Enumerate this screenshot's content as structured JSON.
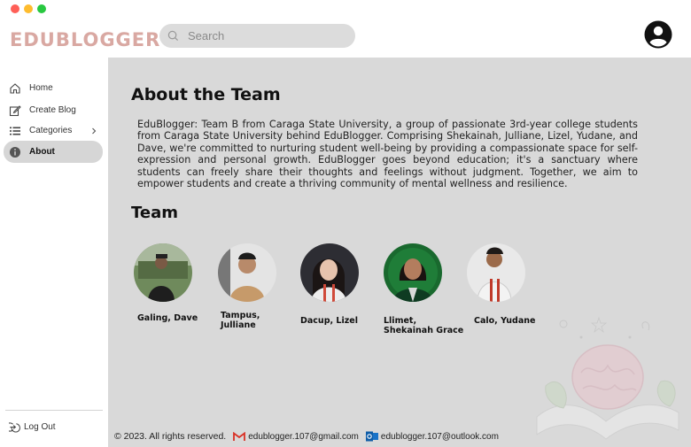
{
  "app": {
    "logo_text": "EDUBLOGGER",
    "colors": {
      "logo": "#d9a8a2",
      "main_bg": "#d9d9d9",
      "active_nav": "#d6d6d6"
    }
  },
  "header": {
    "search": {
      "placeholder": "Search",
      "icon": "search-icon"
    },
    "profile_icon": "user-circle-icon"
  },
  "sidebar": {
    "items": [
      {
        "label": "Home",
        "icon": "home-icon"
      },
      {
        "label": "Create Blog",
        "icon": "edit-icon"
      },
      {
        "label": "Categories",
        "icon": "list-icon"
      },
      {
        "label": "About",
        "icon": "info-icon",
        "active": true
      }
    ],
    "logout_label": "Log Out"
  },
  "main": {
    "title": "About the Team",
    "description": "EduBlogger: Team B from Caraga State University, a group of passionate 3rd-year college students from Caraga State University behind EduBlogger. Comprising Shekainah, Julliane, Lizel, Yudane, and Dave, we're committed  to nurturing student well-being by providing a compassionate space for self-expression and personal growth. EduBlogger goes beyond education; it's a sanctuary where students can freely share their thoughts and feelings without judgment. Together, we aim to empower students and create a thriving community of mental wellness and resilience.",
    "team_heading": "Team",
    "members": [
      {
        "name": "Galing, Dave"
      },
      {
        "name": "Tampus, Julliane"
      },
      {
        "name": "Dacup, Lizel"
      },
      {
        "name": "Llimet, Shekainah Grace"
      },
      {
        "name": "Calo, Yudane"
      }
    ]
  },
  "footer": {
    "copyright": "© 2023. All rights reserved.",
    "gmail": "edublogger.107@gmail.com",
    "outlook": "edublogger.107@outlook.com"
  }
}
